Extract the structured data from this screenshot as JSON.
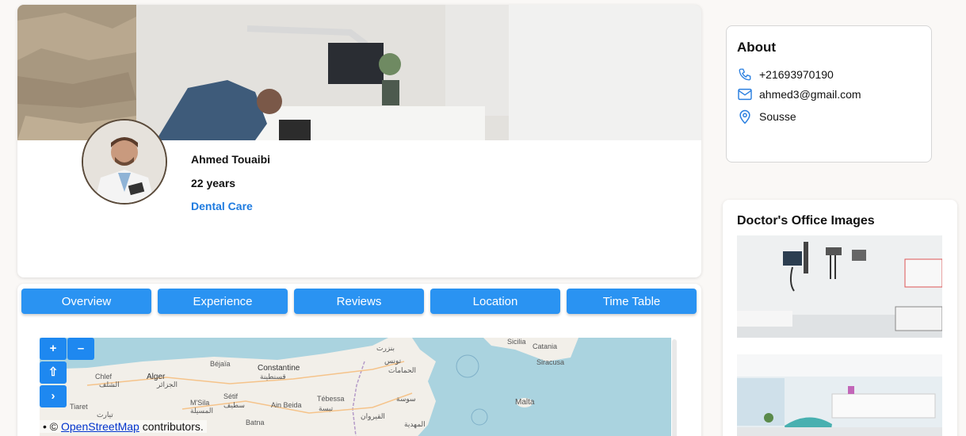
{
  "profile": {
    "name": "Ahmed Touaibi",
    "age": "22 years",
    "specialty": "Dental Care"
  },
  "tabs": [
    "Overview",
    "Experience",
    "Reviews",
    "Location",
    "Time Table"
  ],
  "map": {
    "zoom_in": "+",
    "zoom_out": "–",
    "locate": "⇧",
    "expand": "›",
    "attribution_prefix": "• © ",
    "attribution_link": "OpenStreetMap",
    "attribution_suffix": " contributors.",
    "place_labels": [
      "Sicilia",
      "Catania",
      "Siracusa",
      "بنزرت",
      "تونس",
      "Béjaïa",
      "Constantine",
      "قسنطينة",
      "Chlef",
      "Alger",
      "الجزائر",
      "الشلف",
      "Malta",
      "Tiaret",
      "تيارت",
      "M'Sila",
      "المسيلة",
      "Sétif",
      "سطيف",
      "Ain Beida",
      "Tébessa",
      "تبسة",
      "سوسة",
      "الحمامات",
      "القيروان",
      "المهدية",
      "Batna"
    ]
  },
  "about": {
    "title": "About",
    "phone": "+21693970190",
    "email": "ahmed3@gmail.com",
    "location": "Sousse"
  },
  "office": {
    "title": "Doctor's Office Images"
  },
  "colors": {
    "accent": "#2a93f2",
    "specialty": "#1e7be0"
  }
}
